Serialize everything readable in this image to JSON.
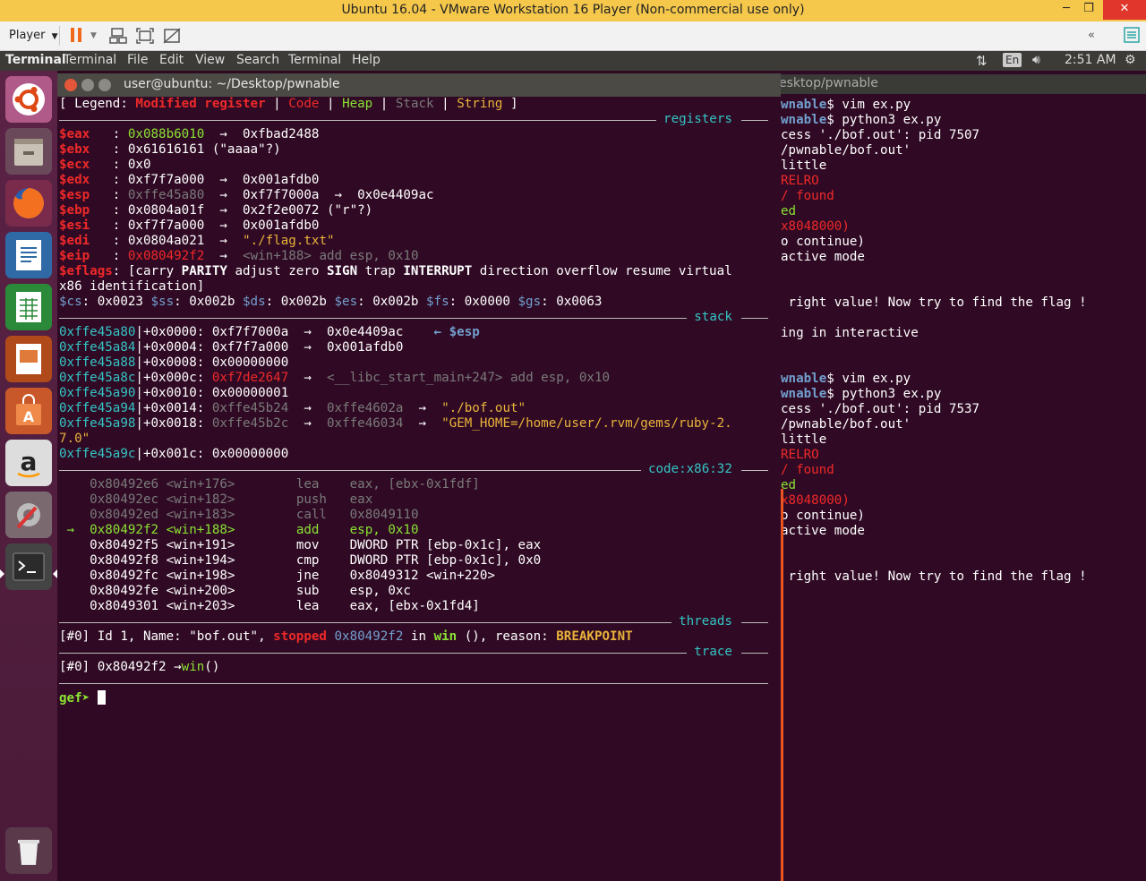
{
  "vm": {
    "title": "Ubuntu 16.04 - VMware Workstation 16 Player (Non-commercial use only)",
    "player_label": "Player",
    "min": "─",
    "max": "❐",
    "close": "✕"
  },
  "topbar": {
    "app_name": "Terminal",
    "menus": [
      "Terminal",
      "File",
      "Edit",
      "View",
      "Search",
      "Terminal",
      "Help"
    ],
    "keyboard": "En",
    "time": "2:51 AM"
  },
  "bg_terminal": {
    "title": "esktop/pwnable",
    "lines": [
      {
        "a": "wnable",
        "b": "$ vim ex.py"
      },
      {
        "a": "wnable",
        "b": "$ python3 ex.py"
      },
      {
        "c": "cess './bof.out': pid 7507"
      },
      {
        "c": "/pwnable/bof.out'"
      },
      {
        "c": "little"
      },
      {
        "r": "RELRO"
      },
      {
        "r": "/ found"
      },
      {
        "g": "ed"
      },
      {
        "r": "x8048000)"
      },
      {
        "c": "o continue)"
      },
      {
        "c": "active mode"
      },
      {
        "c": ""
      },
      {
        "c": ""
      },
      {
        "c": " right value! Now try to find the flag !"
      },
      {
        "c": ""
      },
      {
        "c": "ing in interactive"
      },
      {
        "c": ""
      },
      {
        "c": ""
      },
      {
        "a": "wnable",
        "b": "$ vim ex.py"
      },
      {
        "a": "wnable",
        "b": "$ python3 ex.py"
      },
      {
        "c": "cess './bof.out': pid 7537"
      },
      {
        "c": "/pwnable/bof.out'"
      },
      {
        "c": "little"
      },
      {
        "r": "RELRO"
      },
      {
        "r": "/ found"
      },
      {
        "g": "ed"
      },
      {
        "r": "x8048000)"
      },
      {
        "c": "o continue)"
      },
      {
        "c": "active mode"
      },
      {
        "c": ""
      },
      {
        "c": ""
      },
      {
        "c": " right value! Now try to find the flag !"
      }
    ]
  },
  "main_terminal": {
    "title": "user@ubuntu: ~/Desktop/pwnable",
    "legend": {
      "open": "[ Legend: ",
      "modified": "Modified register",
      "s1": " | ",
      "code": "Code",
      "s2": " | ",
      "heap": "Heap",
      "s3": " | ",
      "stack": "Stack",
      "s4": " | ",
      "string": "String",
      "close": " ]"
    },
    "section_registers": "registers",
    "registers": [
      {
        "name": "$eax",
        "sep": "   : ",
        "v1": "0x088b6010",
        "v1c": "green",
        "rest": "  →  0xfbad2488"
      },
      {
        "name": "$ebx",
        "sep": "   : ",
        "v1": "0x61616161 (\"aaaa\"?)",
        "v1c": "",
        "rest": ""
      },
      {
        "name": "$ecx",
        "sep": "   : ",
        "v1": "0x0",
        "v1c": "",
        "rest": ""
      },
      {
        "name": "$edx",
        "sep": "   : ",
        "v1": "0xf7f7a000",
        "v1c": "",
        "rest": "  →  0x001afdb0"
      },
      {
        "name": "$esp",
        "sep": "   : ",
        "v1": "0xffe45a80",
        "v1c": "dim",
        "rest": "  →  0xf7f7000a  →  0x0e4409ac"
      },
      {
        "name": "$ebp",
        "sep": "   : ",
        "v1": "0x0804a01f",
        "v1c": "",
        "rest": "  →  0x2f2e0072 (\"r\"?)"
      },
      {
        "name": "$esi",
        "sep": "   : ",
        "v1": "0xf7f7a000",
        "v1c": "",
        "rest": "  →  0x001afdb0"
      },
      {
        "name": "$edi",
        "sep": "   : ",
        "v1": "0x0804a021",
        "v1c": "",
        "rest": "  →  ",
        "tail": "\"./flag.txt\"",
        "tailc": "yellow"
      },
      {
        "name": "$eip",
        "sep": "   : ",
        "v1": "0x080492f2",
        "v1c": "red",
        "rest": "  →  ",
        "tail": "<win+188> add esp, 0x10",
        "tailc": "dim"
      }
    ],
    "eflags_label": "$eflags",
    "eflags": [
      {
        "t": ": [carry ",
        "b": false
      },
      {
        "t": "PARITY",
        "b": true
      },
      {
        "t": " adjust zero ",
        "b": false
      },
      {
        "t": "SIGN",
        "b": true
      },
      {
        "t": " trap ",
        "b": false
      },
      {
        "t": "INTERRUPT",
        "b": true
      },
      {
        "t": " direction overflow resume virtual",
        "b": false
      }
    ],
    "eflags_line2": "x86 identification]",
    "segs": [
      {
        "n": "$cs",
        "v": ": 0x0023 "
      },
      {
        "n": "$ss",
        "v": ": 0x002b "
      },
      {
        "n": "$ds",
        "v": ": 0x002b "
      },
      {
        "n": "$es",
        "v": ": 0x002b "
      },
      {
        "n": "$fs",
        "v": ": 0x0000 "
      },
      {
        "n": "$gs",
        "v": ": 0x0063"
      }
    ],
    "section_stack": "stack",
    "stack": [
      {
        "addr": "0xffe45a80",
        "off": "|+0x0000: ",
        "v": "0xf7f7000a",
        "vc": "",
        "rest": "  →  0x0e4409ac",
        "tag": "    ← $esp"
      },
      {
        "addr": "0xffe45a84",
        "off": "|+0x0004: ",
        "v": "0xf7f7a000",
        "vc": "",
        "rest": "  →  0x001afdb0",
        "tag": ""
      },
      {
        "addr": "0xffe45a88",
        "off": "|+0x0008: ",
        "v": "0x00000000",
        "vc": "",
        "rest": "",
        "tag": ""
      },
      {
        "addr": "0xffe45a8c",
        "off": "|+0x000c: ",
        "v": "0xf7de2647",
        "vc": "red",
        "rest": "  →  ",
        "tail": "<__libc_start_main+247> add esp, 0x10",
        "tailc": "dim"
      },
      {
        "addr": "0xffe45a90",
        "off": "|+0x0010: ",
        "v": "0x00000001",
        "vc": "",
        "rest": "",
        "tag": ""
      },
      {
        "addr": "0xffe45a94",
        "off": "|+0x0014: ",
        "v": "0xffe45b24",
        "vc": "dim",
        "rest": "  →  ",
        "mid": "0xffe4602a",
        "tail": "  →  ",
        "tail2": "\"./bof.out\""
      },
      {
        "addr": "0xffe45a98",
        "off": "|+0x0018: ",
        "v": "0xffe45b2c",
        "vc": "dim",
        "rest": "  →  ",
        "mid": "0xffe46034",
        "tail": "  →  ",
        "tail2": "\"GEM_HOME=/home/user/.rvm/gems/ruby-2."
      }
    ],
    "stack_wrap": "7.0\"",
    "stack_last": {
      "addr": "0xffe45a9c",
      "off": "|+0x001c: ",
      "v": "0x00000000"
    },
    "section_code": "code:x86:32",
    "code": [
      {
        "p": "    ",
        "a": "0x80492e6 <win+176>",
        "m": "lea ",
        "o": "eax, [ebx-0x1fdf]",
        "st": "past"
      },
      {
        "p": "    ",
        "a": "0x80492ec <win+182>",
        "m": "push",
        "o": "eax",
        "st": "past"
      },
      {
        "p": "    ",
        "a": "0x80492ed <win+183>",
        "m": "call",
        "o": "0x8049110",
        "st": "past"
      },
      {
        "p": " →  ",
        "a": "0x80492f2 <win+188>",
        "m": "add ",
        "o": "esp, 0x10",
        "st": "cur"
      },
      {
        "p": "    ",
        "a": "0x80492f5 <win+191>",
        "m": "mov ",
        "o": "DWORD PTR [ebp-0x1c], eax",
        "st": "next"
      },
      {
        "p": "    ",
        "a": "0x80492f8 <win+194>",
        "m": "cmp ",
        "o": "DWORD PTR [ebp-0x1c], 0x0",
        "st": "next"
      },
      {
        "p": "    ",
        "a": "0x80492fc <win+198>",
        "m": "jne ",
        "o": "0x8049312 <win+220>",
        "st": "next"
      },
      {
        "p": "    ",
        "a": "0x80492fe <win+200>",
        "m": "sub ",
        "o": "esp, 0xc",
        "st": "next"
      },
      {
        "p": "    ",
        "a": "0x8049301 <win+203>",
        "m": "lea ",
        "o": "eax, [ebx-0x1fd4]",
        "st": "next"
      }
    ],
    "section_threads": "threads",
    "thread": {
      "idx": "[#0]",
      "text": " Id 1, Name: \"bof.out\", ",
      "stopped": "stopped",
      "addr": " 0x80492f2",
      "in": " in ",
      "fn": "win",
      "after": " (), reason: ",
      "reason": "BREAKPOINT"
    },
    "section_trace": "trace",
    "trace": {
      "idx": "[#0]",
      "text": " 0x80492f2 →",
      "fn": "win",
      "after": "()"
    },
    "prompt": "gef➤ "
  },
  "colors": {
    "accent": "#e95420",
    "terminal_bg": "#300a24",
    "green": "#8ae234",
    "red": "#ef2929",
    "cyan": "#34c4c4",
    "yellow": "#e9b33a"
  }
}
